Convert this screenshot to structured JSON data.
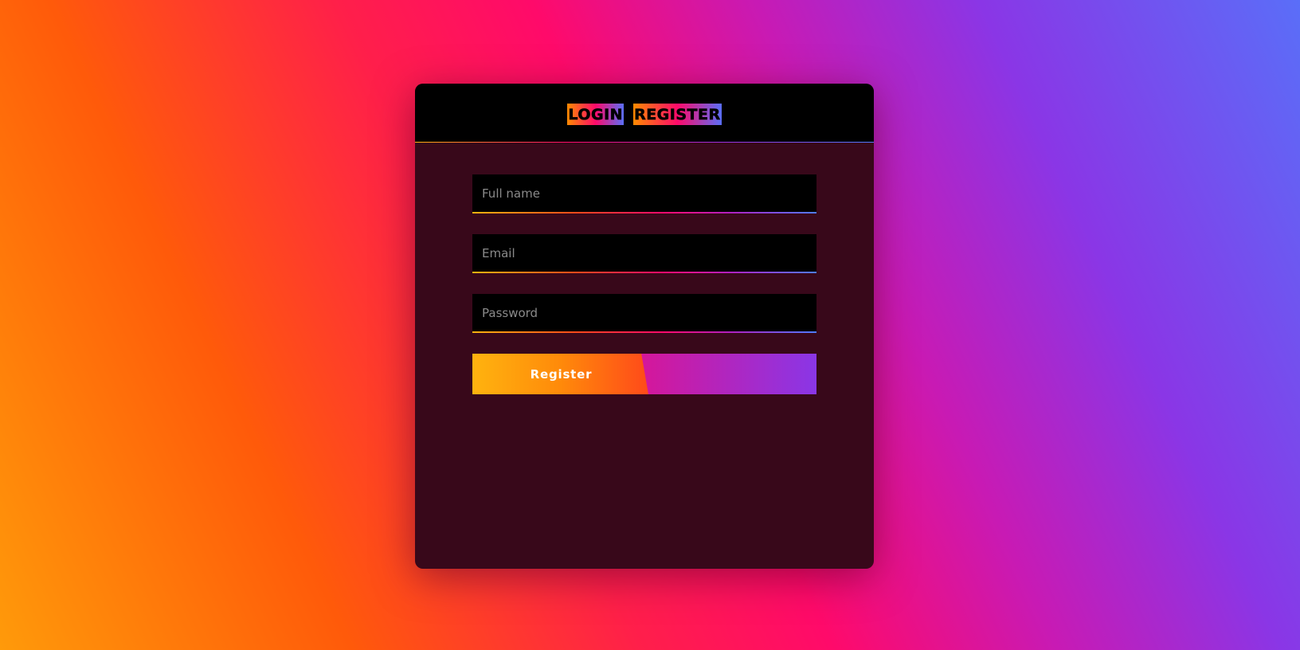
{
  "header": {
    "tabs": [
      {
        "label": "LOGIN"
      },
      {
        "label": "REGISTER"
      }
    ]
  },
  "form": {
    "fields": [
      {
        "placeholder": "Full name",
        "value": ""
      },
      {
        "placeholder": "Email",
        "value": ""
      },
      {
        "placeholder": "Password",
        "value": ""
      }
    ],
    "submit_label": "Register"
  },
  "colors": {
    "card_background": "#38081a",
    "header_background": "#000000",
    "field_background": "#000000",
    "gradient_orange": "#ff8a00",
    "gradient_pink": "#ff0a6a",
    "gradient_purple": "#8a36e6",
    "gradient_blue": "#4f7cff"
  }
}
